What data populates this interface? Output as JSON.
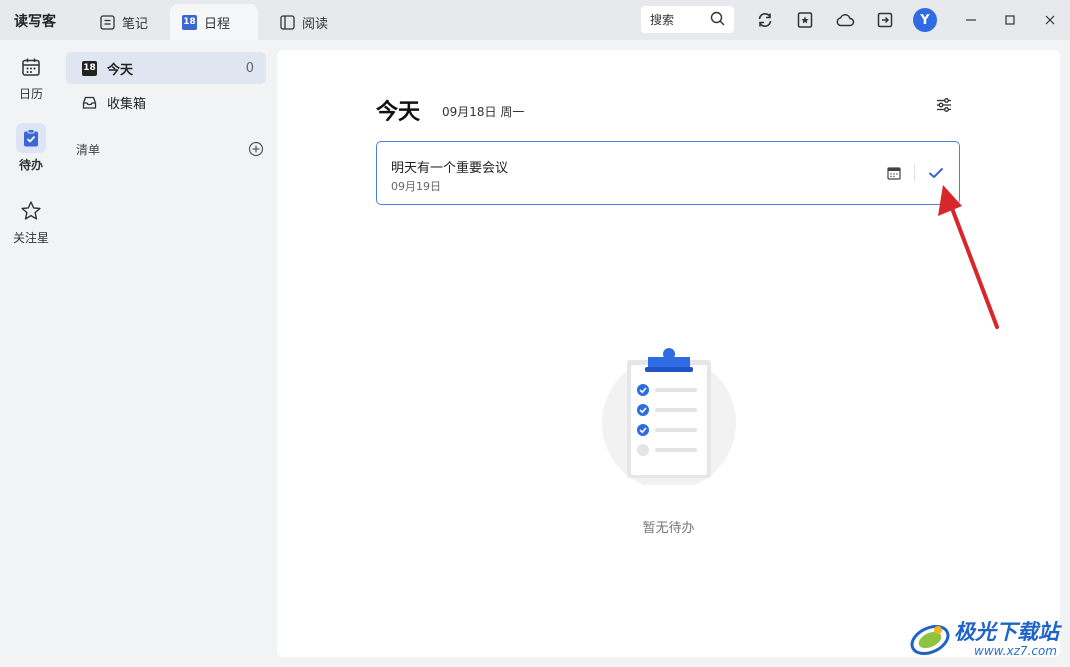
{
  "app": {
    "name": "读写客"
  },
  "tabs": [
    {
      "label": "笔记",
      "icon": "note-icon",
      "active": false
    },
    {
      "label": "日程",
      "icon": "calendar-18-icon",
      "badge": "18",
      "active": true
    },
    {
      "label": "阅读",
      "icon": "book-icon",
      "active": false
    }
  ],
  "toolbar": {
    "search_label": "搜索",
    "icons": [
      "sync-icon",
      "star-doc-icon",
      "cloud-icon",
      "export-icon"
    ],
    "avatar_letter": "Y"
  },
  "window": {
    "controls": [
      "minimize",
      "maximize",
      "close"
    ]
  },
  "rail": {
    "items": [
      {
        "label": "日历",
        "icon": "calendar-icon",
        "active": false
      },
      {
        "label": "待办",
        "icon": "todo-icon",
        "active": true
      },
      {
        "label": "关注星",
        "icon": "star-icon",
        "active": false
      }
    ]
  },
  "sidebar": {
    "today": {
      "label": "今天",
      "badge": "18",
      "count": "0"
    },
    "inbox": {
      "label": "收集箱"
    },
    "lists_title": "清单"
  },
  "main": {
    "heading": "今天",
    "date": "09月18日 周一",
    "task": {
      "title": "明天有一个重要会议",
      "date": "09月19日"
    },
    "empty_text": "暂无待办"
  },
  "watermark": {
    "title": "极光下载站",
    "url": "www.xz7.com"
  },
  "colors": {
    "accent": "#3b66d6",
    "arrow": "#d9262a",
    "card_border": "#4d7fe0"
  }
}
